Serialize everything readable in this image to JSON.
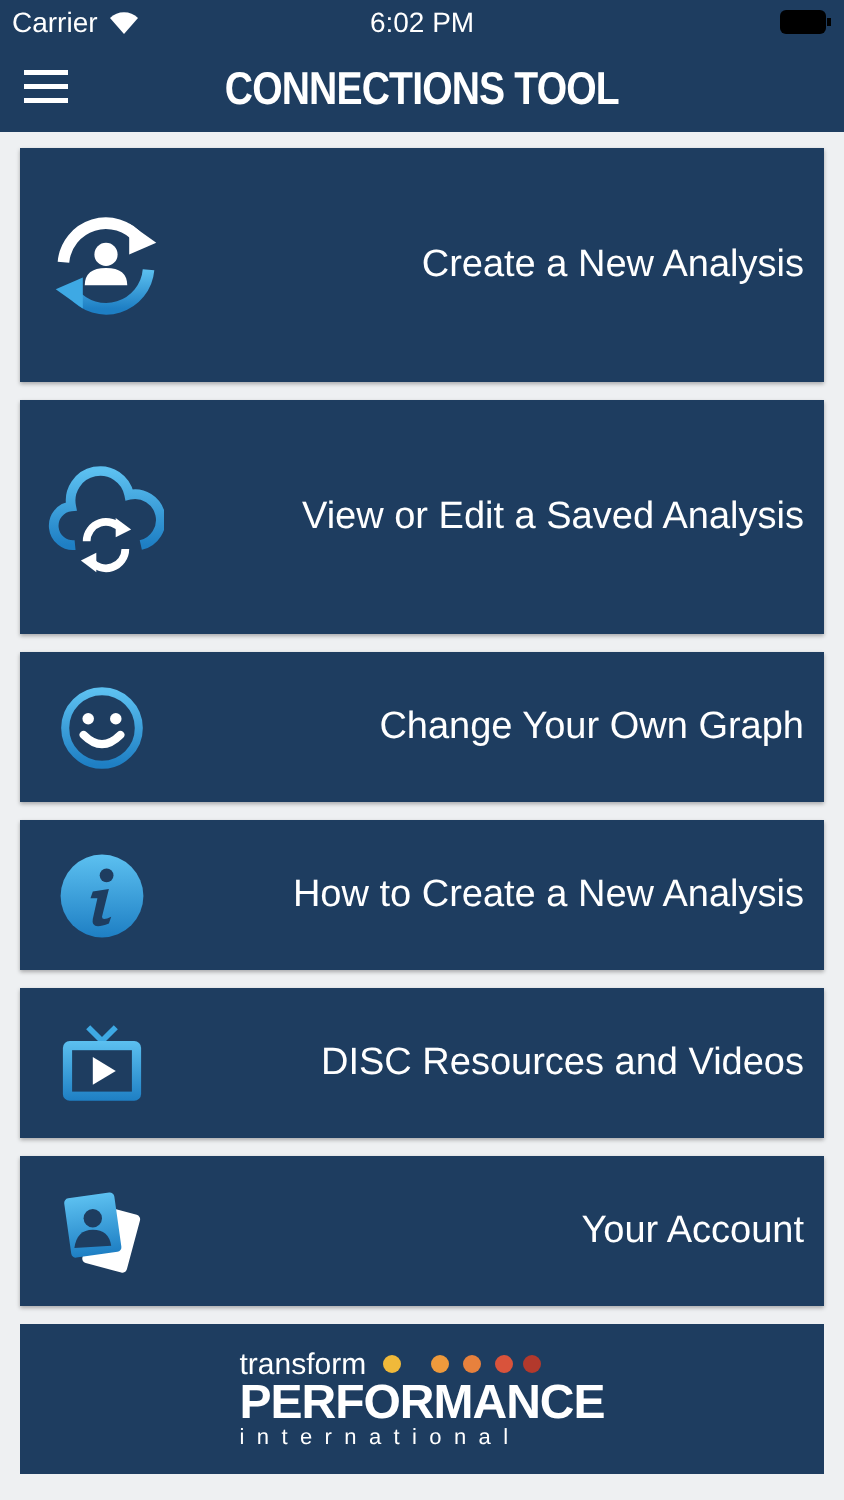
{
  "status_bar": {
    "carrier": "Carrier",
    "time": "6:02 PM"
  },
  "nav_bar": {
    "title": "CONNECTIONS TOOL"
  },
  "menu": [
    {
      "label": "Create a New Analysis",
      "kind": "large"
    },
    {
      "label": "View or Edit a Saved Analysis",
      "kind": "large"
    },
    {
      "label": "Change Your Own Graph",
      "kind": "compact"
    },
    {
      "label": "How to Create a New Analysis",
      "kind": "compact"
    },
    {
      "label": "DISC Resources and Videos",
      "kind": "compact"
    },
    {
      "label": "Your Account",
      "kind": "compact"
    }
  ],
  "logo": {
    "line_1": "transform",
    "line_2": "PERFORMANCE",
    "line_3": "international"
  }
}
